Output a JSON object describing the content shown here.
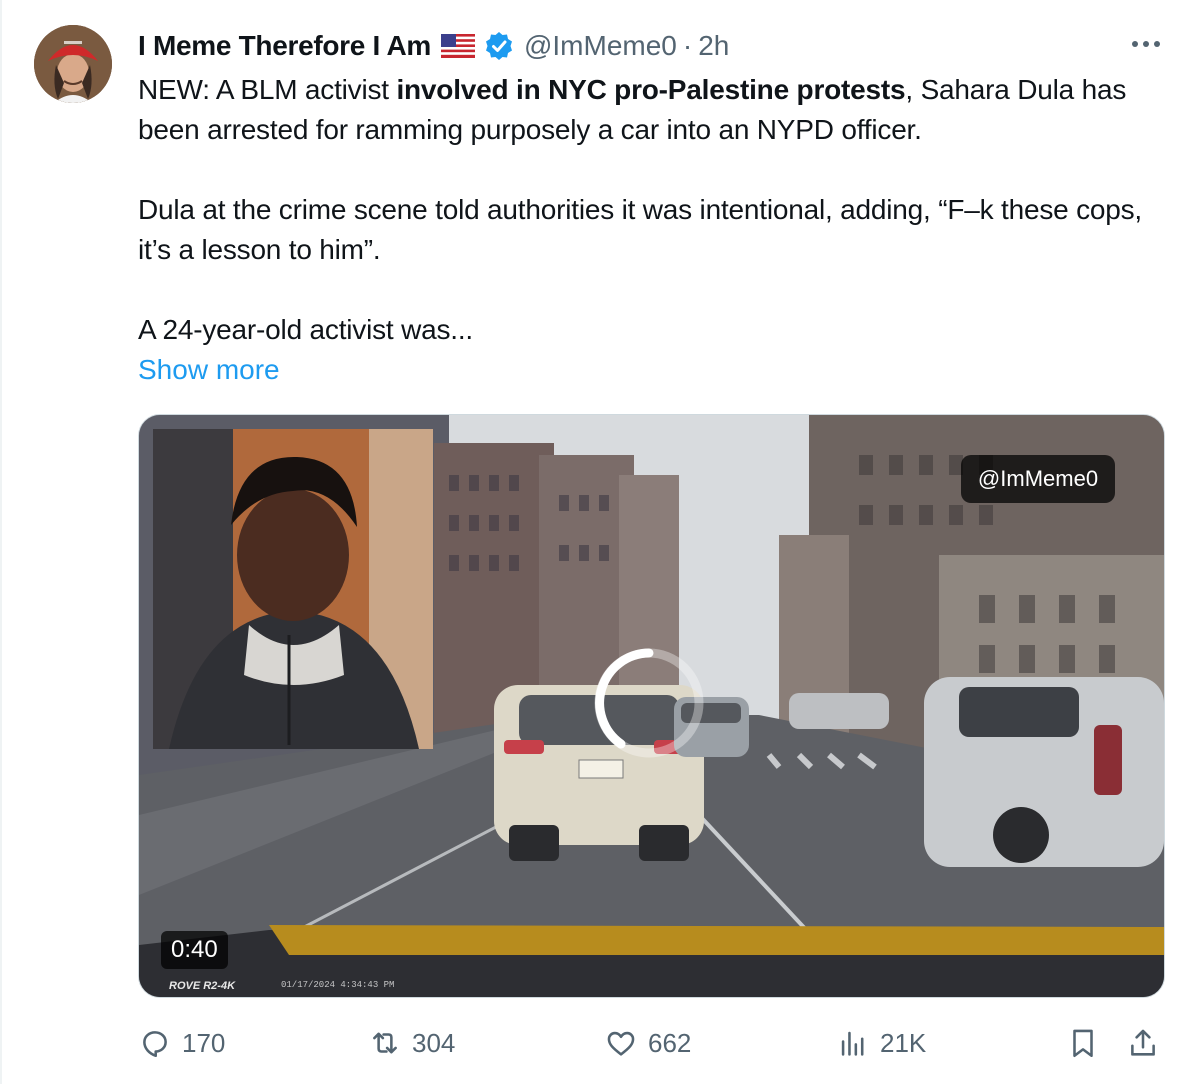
{
  "tweet": {
    "author_name": "I Meme Therefore I Am",
    "flag_icon": "us-flag-icon",
    "verified_icon": "verified-badge-icon",
    "handle": "@ImMeme0",
    "separator": "·",
    "time": "2h",
    "text": {
      "p1_prefix": "NEW: A BLM activist ",
      "p1_bold": "involved in NYC pro-Palestine protests",
      "p1_suffix": ", Sahara Dula has been arrested for ramming purposely a car into an NYPD officer.",
      "p2": "Dula at the crime scene told authorities it was intentional, adding, “F–k these cops, it’s a lesson to him”.",
      "p3": "A 24-year-old activist was..."
    },
    "show_more": "Show more"
  },
  "media": {
    "watermark": "@ImMeme0",
    "duration": "0:40",
    "dashcam_brand": "ROVE R2-4K",
    "dashcam_timestamp": "01/17/2024 4:34:43 PM"
  },
  "actions": {
    "replies": "170",
    "reposts": "304",
    "likes": "662",
    "views": "21K"
  },
  "colors": {
    "accent": "#1d9bf0",
    "secondary_text": "#536471",
    "border": "#cfd9de"
  }
}
